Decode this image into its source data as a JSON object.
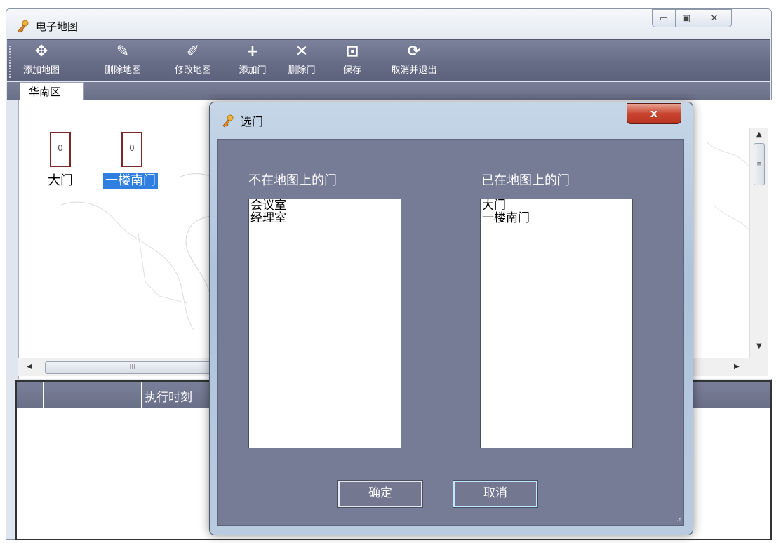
{
  "window": {
    "title": "电子地图",
    "controls": {
      "minimize_icon": "minimize-icon",
      "maximize_icon": "maximize-icon",
      "close_icon": "close-icon"
    }
  },
  "toolbar": {
    "items": [
      {
        "label": "添加地图",
        "icon": "add-map-icon",
        "glyph": "✥"
      },
      {
        "label": "删除地图",
        "icon": "delete-map-icon",
        "glyph": "✎"
      },
      {
        "label": "修改地图",
        "icon": "edit-map-icon",
        "glyph": "✐"
      },
      {
        "label": "添加门",
        "icon": "plus-icon",
        "glyph": "+"
      },
      {
        "label": "删除门",
        "icon": "cross-icon",
        "glyph": "✕"
      },
      {
        "label": "保存",
        "icon": "save-icon",
        "glyph": "⊡"
      },
      {
        "label": "取消并退出",
        "icon": "refresh-exit-icon",
        "glyph": "⟳"
      }
    ]
  },
  "map": {
    "tab_label": "华南区",
    "doors": [
      {
        "label": "大门",
        "marker_text": "0",
        "selected": false
      },
      {
        "label": "一楼南门",
        "marker_text": "0",
        "selected": true
      }
    ],
    "vscroll_thumb": "≡",
    "hscroll_thumb": "III"
  },
  "grid": {
    "columns": [
      "",
      "",
      "执行时刻"
    ]
  },
  "dialog": {
    "title": "选门",
    "close_label": "x",
    "left_header": "不在地图上的门",
    "right_header": "已在地图上的门",
    "left_items": [
      "会议室",
      "经理室"
    ],
    "right_items": [
      "大门",
      "一楼南门"
    ],
    "ok_label": "确定",
    "cancel_label": "取消"
  }
}
